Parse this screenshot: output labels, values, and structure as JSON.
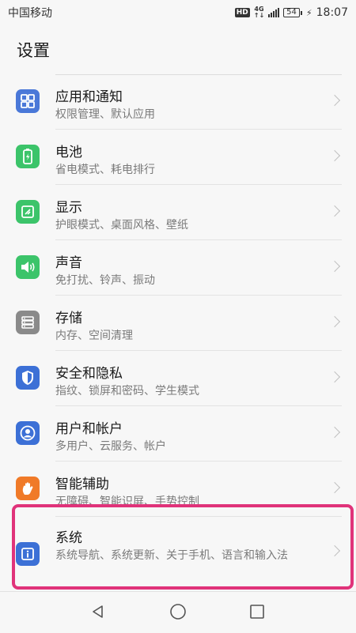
{
  "status_bar": {
    "carrier": "中国移动",
    "hd": "HD",
    "network_top": "4G",
    "network_bottom": "↑↓",
    "battery": "54",
    "time": "18:07"
  },
  "header": {
    "title": "设置"
  },
  "settings": {
    "items": [
      {
        "label": "应用和通知",
        "desc": "权限管理、默认应用",
        "color": "#4a78d8",
        "icon": "apps-grid-icon"
      },
      {
        "label": "电池",
        "desc": "省电模式、耗电排行",
        "color": "#3cc46a",
        "icon": "battery-icon"
      },
      {
        "label": "显示",
        "desc": "护眼模式、桌面风格、壁纸",
        "color": "#3cc46a",
        "icon": "display-icon"
      },
      {
        "label": "声音",
        "desc": "免打扰、铃声、振动",
        "color": "#3cc46a",
        "icon": "speaker-icon"
      },
      {
        "label": "存储",
        "desc": "内存、空间清理",
        "color": "#8a8a8a",
        "icon": "storage-icon"
      },
      {
        "label": "安全和隐私",
        "desc": "指纹、锁屏和密码、学生模式",
        "color": "#3c70d6",
        "icon": "shield-icon"
      },
      {
        "label": "用户和帐户",
        "desc": "多用户、云服务、帐户",
        "color": "#3c70d6",
        "icon": "user-icon"
      },
      {
        "label": "智能辅助",
        "desc": "无障碍、智能识屏、手势控制",
        "color": "#f07a28",
        "icon": "hand-icon"
      },
      {
        "label": "系统",
        "desc": "系统导航、系统更新、关于手机、语言和输入法",
        "color": "#3c70d6",
        "icon": "info-icon"
      }
    ]
  },
  "highlight_color": "#e0337a"
}
